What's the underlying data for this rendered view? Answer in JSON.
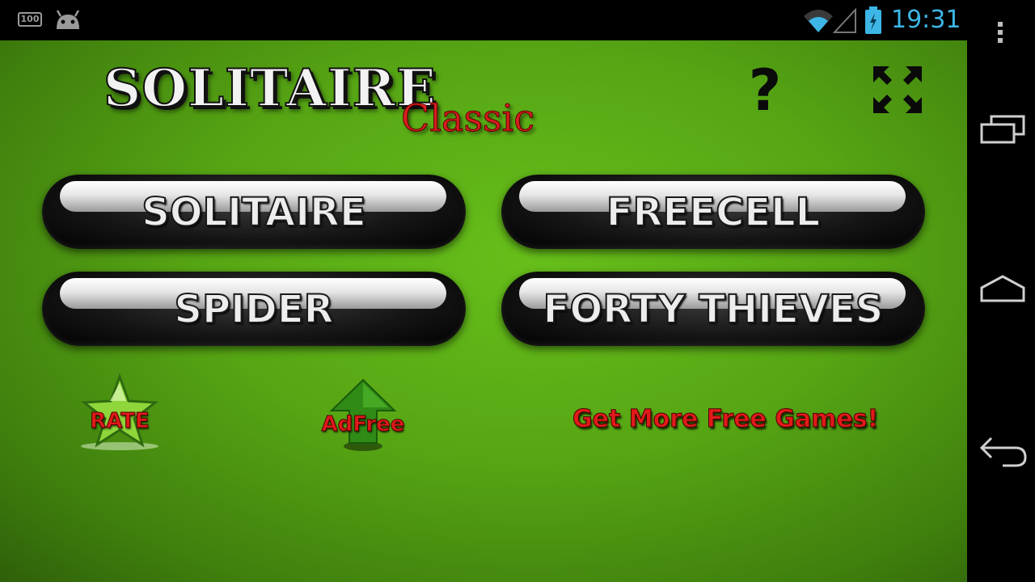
{
  "status_bar": {
    "battery_percent": "100",
    "time": "19:31",
    "time_color": "#3db6e6",
    "icons": [
      "battery-percent-icon",
      "android-debug-icon",
      "wifi-icon",
      "signal-icon",
      "battery-charging-icon"
    ]
  },
  "logo": {
    "title": "SOLITAIRE",
    "subtitle": "Classic"
  },
  "header": {
    "help_label": "?",
    "fullscreen_icon": "fullscreen-icon"
  },
  "games": [
    {
      "label": "SOLITAIRE"
    },
    {
      "label": "FREECELL"
    },
    {
      "label": "SPIDER"
    },
    {
      "label": "FORTY THIEVES"
    }
  ],
  "extras": {
    "rate_label": "RATE",
    "adfree_label": "AdFree",
    "more_games_label": "Get More Free Games!"
  },
  "colors": {
    "felt": "#56a514",
    "accent_red": "#e01a1a"
  },
  "nav_bar": {
    "icons": [
      "menu-icon",
      "recent-apps-icon",
      "home-icon",
      "back-icon"
    ]
  }
}
